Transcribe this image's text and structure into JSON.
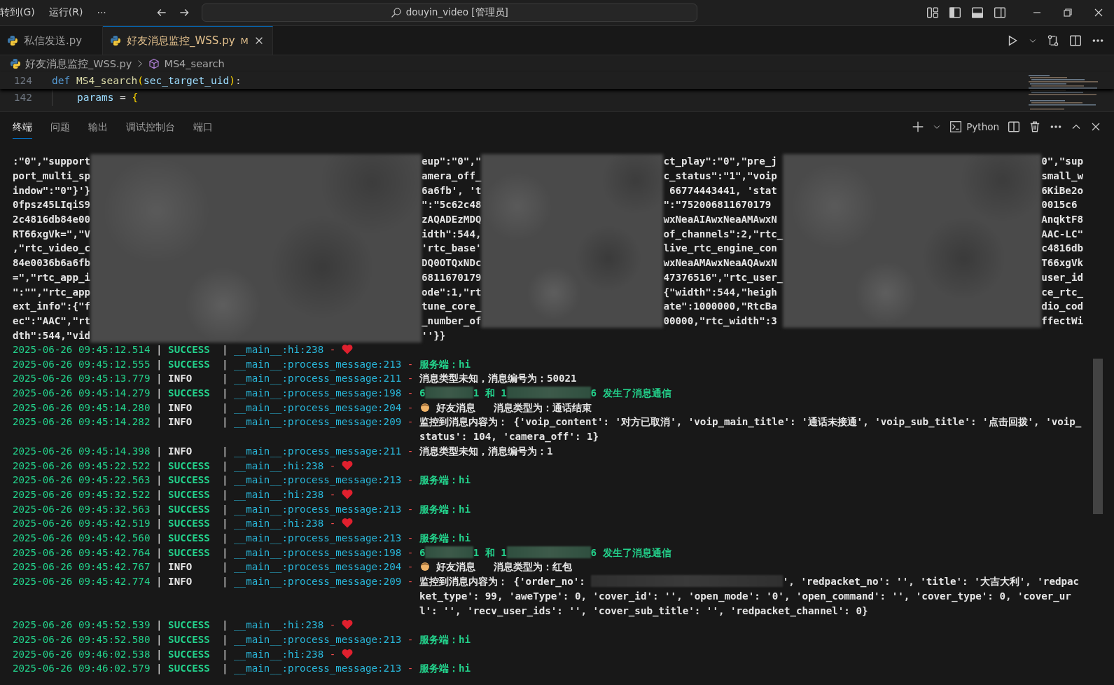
{
  "title_bar": {
    "menus": [
      {
        "label": "转到(G)"
      },
      {
        "label": "运行(R)"
      }
    ],
    "more": "···",
    "search": {
      "value": "douyin_video [管理员]"
    }
  },
  "editor_tabs": [
    {
      "label": "私信发送.py",
      "selected": false
    },
    {
      "label": "好友消息监控_WSS.py",
      "selected": true,
      "badge": "M"
    }
  ],
  "breadcrumb": {
    "file": "好友消息监控_WSS.py",
    "symbol": "MS4_search"
  },
  "code_lines": [
    {
      "number": "124",
      "indent": false,
      "tokens": [
        {
          "kind": "keyword",
          "text": "def"
        },
        {
          "kind": "function",
          "text": "MS4_search"
        },
        {
          "kind": "bracket",
          "text": "("
        },
        {
          "kind": "variable",
          "text": "sec_target_uid"
        },
        {
          "kind": "bracket",
          "text": ")"
        },
        {
          "kind": "plain",
          "text": ":"
        }
      ]
    },
    {
      "number": "142",
      "indent": true,
      "tokens": [
        {
          "kind": "variable",
          "text": "params"
        },
        {
          "kind": "plain",
          "text": " = "
        },
        {
          "kind": "bracket",
          "text": "{"
        }
      ]
    }
  ],
  "panel_tabs": [
    {
      "label": "终端",
      "selected": true
    },
    {
      "label": "问题",
      "selected": false
    },
    {
      "label": "输出",
      "selected": false
    },
    {
      "label": "调试控制台",
      "selected": false
    },
    {
      "label": "端口",
      "selected": false
    }
  ],
  "terminal_profile": "Python",
  "raw_output": [
    [
      ":\"0\",\"support",
      "eup\":\"0\",\"",
      "ct_play\":\"0\",\"pre_j",
      "0\",\"sup"
    ],
    [
      "port_multi_sp",
      "amera_off_",
      "c_status\":\"1\",\"voip",
      "small_w"
    ],
    [
      "indow\":\"0\"}'}",
      "6a6fb', 't",
      " 66774443441, 'stat",
      "6KiBe2o"
    ],
    [
      "0fpsz45LIqiS9",
      "\":\"5c62c48",
      "\":\"752006811670179",
      "0015c6"
    ],
    [
      "2c4816db84e00",
      "zAQADEzMDQ",
      "wxNeaAIAwxNeaAMAwxN",
      "AnqktF8"
    ],
    [
      "RT66xgVk=\",\"V",
      "idth\":544,",
      "of_channels\":2,\"rtc_",
      "AAC-LC\""
    ],
    [
      ",\"rtc_video_c",
      "'rtc_base'",
      "live_rtc_engine_con",
      "c4816db"
    ],
    [
      "84e0036b6a6fb",
      "DQ0OTQxNDc",
      "wxNeaAMAwxNeaAQAwxN",
      "T66xgVk"
    ],
    [
      "=\",\"rtc_app_i",
      "6811670179",
      "47376516\",\"rtc_user_",
      "user_id"
    ],
    [
      "\":\"\",\"rtc_app",
      "ode\":1,\"rt",
      "{\"width\":544,\"heigh",
      "ce_rtc_"
    ],
    [
      "ext_info\":{\"f",
      "tune_core_",
      "ate\":1000000,\"RtcBa",
      "dio_cod"
    ],
    [
      "ec\":\"AAC\",\"rt",
      "_number_of",
      "00000,\"rtc_width\":3",
      "ffectWi"
    ],
    [
      "dth\":544,\"vid",
      "''}}"
    ]
  ],
  "log": [
    {
      "time": "2025-06-26 09:45:12.514",
      "sep1": "|",
      "level": "SUCCESS",
      "kind": "success",
      "sep2": "|",
      "source": "__main__:hi:238",
      "dash": "-",
      "message": [
        {
          "kind": "heart"
        }
      ]
    },
    {
      "time": "2025-06-26 09:45:12.555",
      "sep1": "|",
      "level": "SUCCESS",
      "kind": "success",
      "sep2": "|",
      "source": "__main__:process_message:213",
      "dash": "-",
      "message": [
        {
          "kind": "text",
          "text": "服务端：hi"
        }
      ]
    },
    {
      "time": "2025-06-26 09:45:13.779",
      "sep1": "|",
      "level": "INFO",
      "kind": "info",
      "sep2": "|",
      "source": "__main__:process_message:211",
      "dash": "-",
      "message": [
        {
          "kind": "text",
          "text": "消息类型未知，消息编号为：50021"
        }
      ]
    },
    {
      "time": "2025-06-26 09:45:14.279",
      "sep1": "|",
      "level": "SUCCESS",
      "kind": "success",
      "sep2": "|",
      "source": "__main__:process_message:198",
      "dash": "-",
      "message": [
        {
          "kind": "text",
          "text": "6"
        },
        {
          "kind": "redacted_short"
        },
        {
          "kind": "text",
          "text": "1 和 1"
        },
        {
          "kind": "redacted_long"
        },
        {
          "kind": "text",
          "text": "6 发生了消息通信"
        }
      ]
    },
    {
      "time": "2025-06-26 09:45:14.280",
      "sep1": "|",
      "level": "INFO",
      "kind": "info",
      "sep2": "|",
      "source": "__main__:process_message:204",
      "dash": "-",
      "message": [
        {
          "kind": "person"
        },
        {
          "kind": "text",
          "text": " 好友消息   消息类型为：通话结束"
        }
      ]
    },
    {
      "time": "2025-06-26 09:45:14.282",
      "sep1": "|",
      "level": "INFO",
      "kind": "info",
      "sep2": "|",
      "source": "__main__:process_message:209",
      "dash": "-",
      "message": [
        {
          "kind": "text",
          "text": "监控到消息内容为： {'voip_content': '对方已取消', 'voip_main_title': '通话未接通', 'voip_sub_title': '点击回拨', 'voip_status': 104, 'camera_off': 1}"
        }
      ]
    },
    {
      "time": "2025-06-26 09:45:14.398",
      "sep1": "|",
      "level": "INFO",
      "kind": "info",
      "sep2": "|",
      "source": "__main__:process_message:211",
      "dash": "-",
      "message": [
        {
          "kind": "text",
          "text": "消息类型未知，消息编号为：1"
        }
      ]
    },
    {
      "time": "2025-06-26 09:45:22.522",
      "sep1": "|",
      "level": "SUCCESS",
      "kind": "success",
      "sep2": "|",
      "source": "__main__:hi:238",
      "dash": "-",
      "message": [
        {
          "kind": "heart"
        }
      ]
    },
    {
      "time": "2025-06-26 09:45:22.563",
      "sep1": "|",
      "level": "SUCCESS",
      "kind": "success",
      "sep2": "|",
      "source": "__main__:process_message:213",
      "dash": "-",
      "message": [
        {
          "kind": "text",
          "text": "服务端：hi"
        }
      ]
    },
    {
      "time": "2025-06-26 09:45:32.522",
      "sep1": "|",
      "level": "SUCCESS",
      "kind": "success",
      "sep2": "|",
      "source": "__main__:hi:238",
      "dash": "-",
      "message": [
        {
          "kind": "heart"
        }
      ]
    },
    {
      "time": "2025-06-26 09:45:32.563",
      "sep1": "|",
      "level": "SUCCESS",
      "kind": "success",
      "sep2": "|",
      "source": "__main__:process_message:213",
      "dash": "-",
      "message": [
        {
          "kind": "text",
          "text": "服务端：hi"
        }
      ]
    },
    {
      "time": "2025-06-26 09:45:42.519",
      "sep1": "|",
      "level": "SUCCESS",
      "kind": "success",
      "sep2": "|",
      "source": "__main__:hi:238",
      "dash": "-",
      "message": [
        {
          "kind": "heart"
        }
      ]
    },
    {
      "time": "2025-06-26 09:45:42.560",
      "sep1": "|",
      "level": "SUCCESS",
      "kind": "success",
      "sep2": "|",
      "source": "__main__:process_message:213",
      "dash": "-",
      "message": [
        {
          "kind": "text",
          "text": "服务端：hi"
        }
      ]
    },
    {
      "time": "2025-06-26 09:45:42.764",
      "sep1": "|",
      "level": "SUCCESS",
      "kind": "success",
      "sep2": "|",
      "source": "__main__:process_message:198",
      "dash": "-",
      "message": [
        {
          "kind": "text",
          "text": "6"
        },
        {
          "kind": "redacted_short"
        },
        {
          "kind": "text",
          "text": "1 和 1"
        },
        {
          "kind": "redacted_long"
        },
        {
          "kind": "text",
          "text": "6 发生了消息通信"
        }
      ]
    },
    {
      "time": "2025-06-26 09:45:42.767",
      "sep1": "|",
      "level": "INFO",
      "kind": "info",
      "sep2": "|",
      "source": "__main__:process_message:204",
      "dash": "-",
      "message": [
        {
          "kind": "person"
        },
        {
          "kind": "text",
          "text": " 好友消息   消息类型为：红包"
        }
      ]
    },
    {
      "time": "2025-06-26 09:45:42.774",
      "sep1": "|",
      "level": "INFO",
      "kind": "info",
      "sep2": "|",
      "source": "__main__:process_message:209",
      "dash": "-",
      "message": [
        {
          "kind": "text",
          "text": "监控到消息内容为： {'order_no': "
        },
        {
          "kind": "redacted_wide"
        },
        {
          "kind": "text",
          "text": "', 'redpacket_no': '', 'title': '大吉大利', 'redpacket_type': 99, 'aweType': 0, 'cover_id': '', 'open_mode': '0', 'open_command': '', 'cover_type': 0, 'cover_url': '', 'recv_user_ids': '', 'cover_sub_title': '', 'redpacket_channel': 0}"
        }
      ]
    },
    {
      "time": "2025-06-26 09:45:52.539",
      "sep1": "|",
      "level": "SUCCESS",
      "kind": "success",
      "sep2": "|",
      "source": "__main__:hi:238",
      "dash": "-",
      "message": [
        {
          "kind": "heart"
        }
      ]
    },
    {
      "time": "2025-06-26 09:45:52.580",
      "sep1": "|",
      "level": "SUCCESS",
      "kind": "success",
      "sep2": "|",
      "source": "__main__:process_message:213",
      "dash": "-",
      "message": [
        {
          "kind": "text",
          "text": "服务端：hi"
        }
      ]
    },
    {
      "time": "2025-06-26 09:46:02.538",
      "sep1": "|",
      "level": "SUCCESS",
      "kind": "success",
      "sep2": "|",
      "source": "__main__:hi:238",
      "dash": "-",
      "message": [
        {
          "kind": "heart"
        }
      ]
    },
    {
      "time": "2025-06-26 09:46:02.579",
      "sep1": "|",
      "level": "SUCCESS",
      "kind": "success",
      "sep2": "|",
      "source": "__main__:process_message:213",
      "dash": "-",
      "message": [
        {
          "kind": "text",
          "text": "服务端：hi"
        }
      ]
    }
  ]
}
